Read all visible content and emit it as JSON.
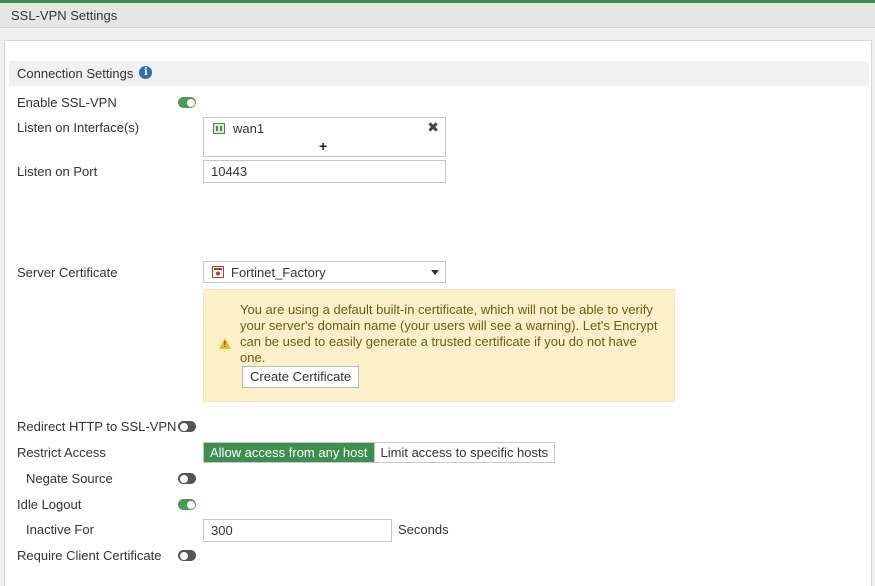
{
  "title": "SSL-VPN Settings",
  "section": {
    "title": "Connection Settings",
    "info_icon": "info-icon"
  },
  "enable_sslvpn": {
    "label": "Enable SSL-VPN",
    "enabled": true
  },
  "listen_interface": {
    "label": "Listen on Interface(s)",
    "items": [
      "wan1"
    ],
    "add_label": "+",
    "remove_label": "✖"
  },
  "listen_port": {
    "label": "Listen on Port",
    "value": "10443"
  },
  "server_certificate": {
    "label": "Server Certificate",
    "value": "Fortinet_Factory",
    "warning": "You are using a default built-in certificate, which will not be able to verify your server's domain name (your users will see a warning). Let's Encrypt can be used to easily generate a trusted certificate if you do not have one.",
    "create_button": "Create Certificate"
  },
  "redirect_http": {
    "label": "Redirect HTTP to SSL-VPN",
    "enabled": false
  },
  "restrict_access": {
    "label": "Restrict Access",
    "options": [
      "Allow access from any host",
      "Limit access to specific hosts"
    ],
    "selected": "Allow access from any host"
  },
  "negate_source": {
    "label": "Negate Source",
    "enabled": false
  },
  "idle_logout": {
    "label": "Idle Logout",
    "enabled": true
  },
  "inactive_for": {
    "label": "Inactive For",
    "value": "300",
    "unit": "Seconds"
  },
  "require_client_cert": {
    "label": "Require Client Certificate",
    "enabled": false
  },
  "colors": {
    "accent": "#3d8f4f",
    "warning_bg": "#fcf1c9",
    "info": "#2f6fb0"
  }
}
